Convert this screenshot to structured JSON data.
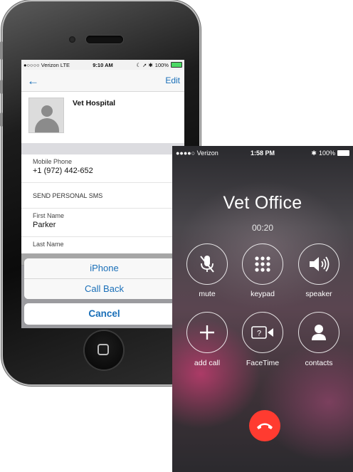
{
  "phone1": {
    "status": {
      "carrier": "●○○○○ Verizon  LTE",
      "time": "9:10 AM",
      "icons": "☾ ➚ ✱",
      "battery": "100%"
    },
    "nav": {
      "edit": "Edit"
    },
    "contact": {
      "name": "Vet Hospital",
      "mobile_label": "Mobile Phone",
      "mobile_value": "+1 (972) 442-652",
      "sms_label": "SEND PERSONAL SMS",
      "first_name_label": "First Name",
      "first_name_value": "Parker",
      "last_name_label": "Last Name"
    },
    "action_sheet": {
      "option1": "iPhone",
      "option2": "Call Back",
      "cancel": "Cancel"
    }
  },
  "phone2": {
    "status": {
      "carrier": "●●●●○ Verizon",
      "time": "1:58 PM",
      "battery": "100%"
    },
    "caller": "Vet Office",
    "timer": "00:20",
    "buttons": {
      "mute": "mute",
      "keypad": "keypad",
      "speaker": "speaker",
      "add_call": "add call",
      "facetime": "FaceTime",
      "contacts": "contacts"
    },
    "colors": {
      "end_call": "#ff3b30",
      "link": "#1a6fb8"
    }
  }
}
